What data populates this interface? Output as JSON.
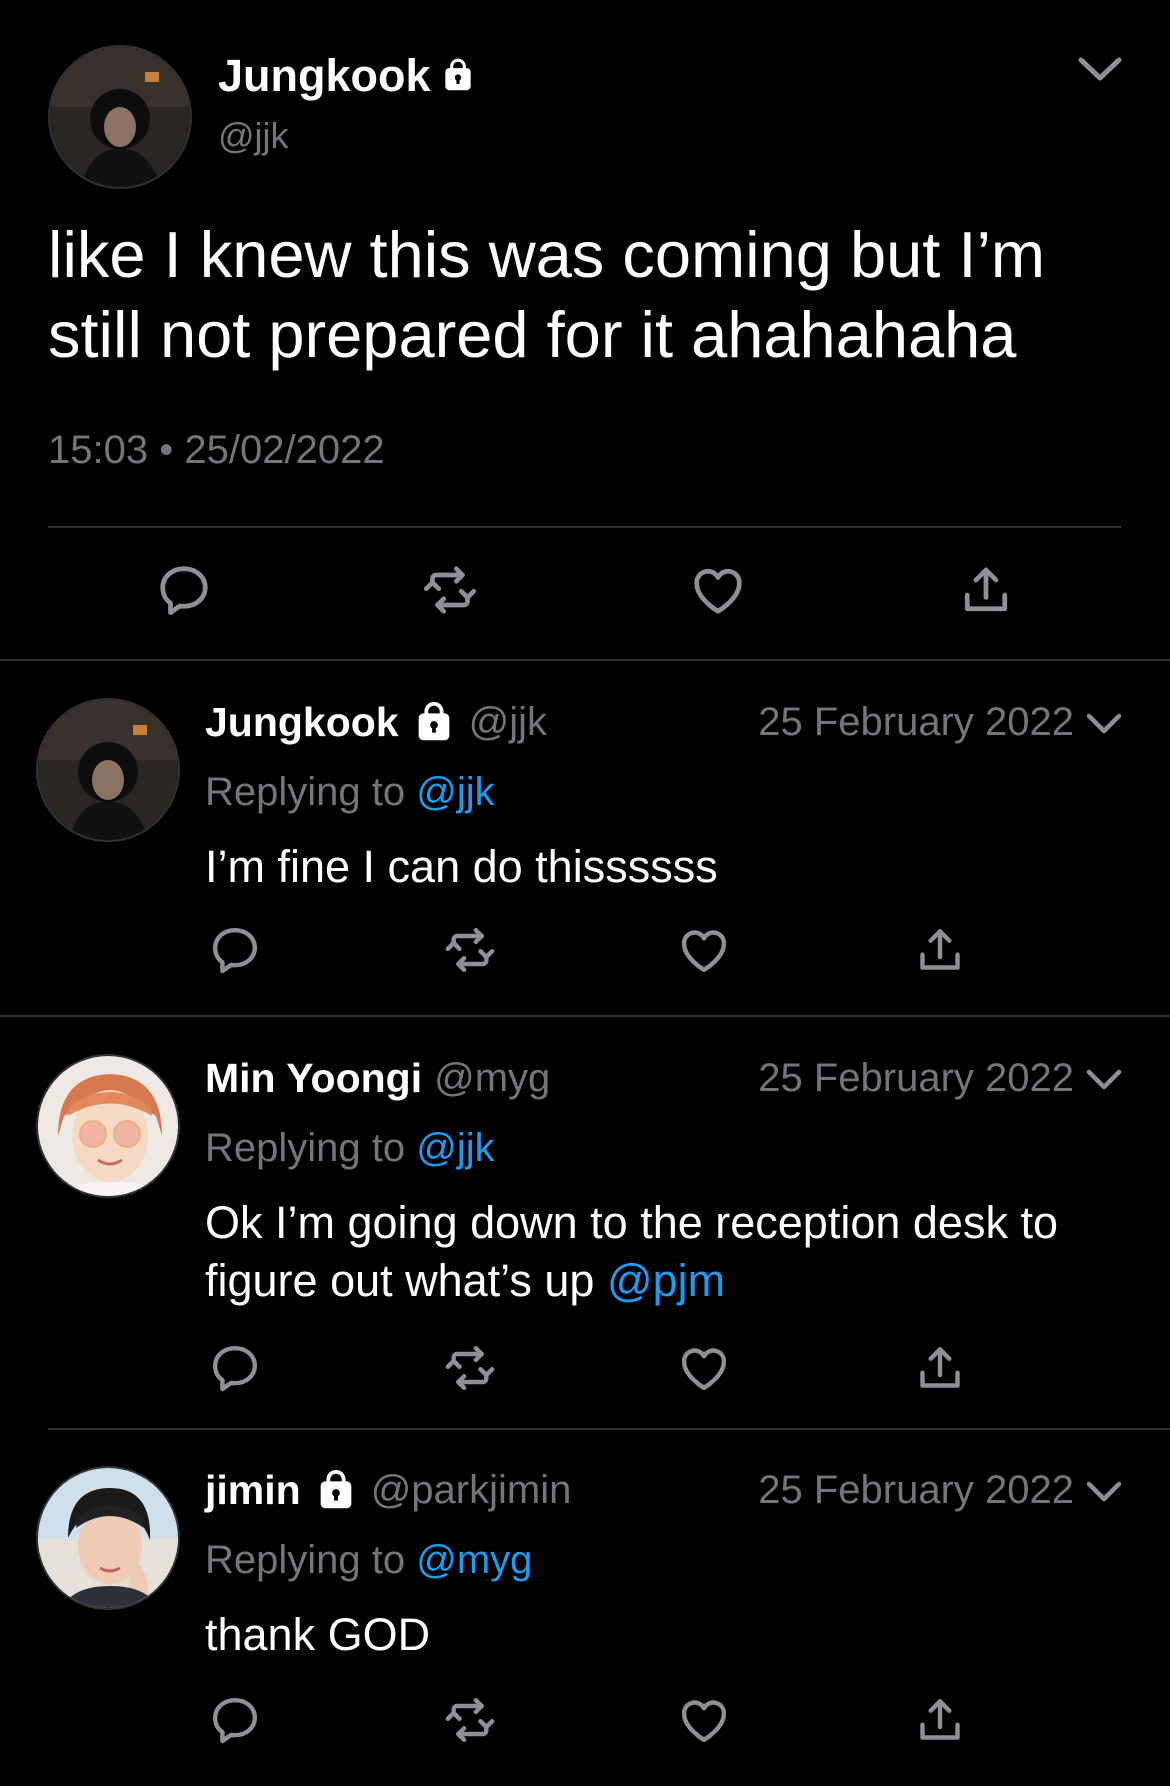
{
  "colors": {
    "background": "#000000",
    "text_primary": "#ffffff",
    "text_secondary": "#71767b",
    "mention": "#1d9bf0",
    "divider": "#2f3336"
  },
  "main_tweet": {
    "display_name": "Jungkook",
    "handle": "@jjk",
    "protected": true,
    "text": "like I knew this was coming but I’m still not prepared for it ahahahaha",
    "time": "15:03",
    "separator": "•",
    "date": "25/02/2022",
    "actions": [
      "reply-icon",
      "retweet-icon",
      "like-icon",
      "share-icon"
    ]
  },
  "replies": [
    {
      "display_name": "Jungkook",
      "handle": "@jjk",
      "protected": true,
      "date": "25 February 2022",
      "replying_label": "Replying to",
      "replying_to": "@jjk",
      "text": "I’m fine I can do thissssss",
      "mention_in_text": ""
    },
    {
      "display_name": "Min Yoongi",
      "handle": "@myg",
      "protected": false,
      "date": "25 February 2022",
      "replying_label": "Replying to",
      "replying_to": "@jjk",
      "text": "Ok I’m going down to the reception desk to figure out what’s up ",
      "mention_in_text": "@pjm"
    },
    {
      "display_name": "jimin",
      "handle": "@parkjimin",
      "protected": true,
      "date": "25 February 2022",
      "replying_label": "Replying to",
      "replying_to": "@myg",
      "text": "thank GOD",
      "mention_in_text": ""
    }
  ]
}
